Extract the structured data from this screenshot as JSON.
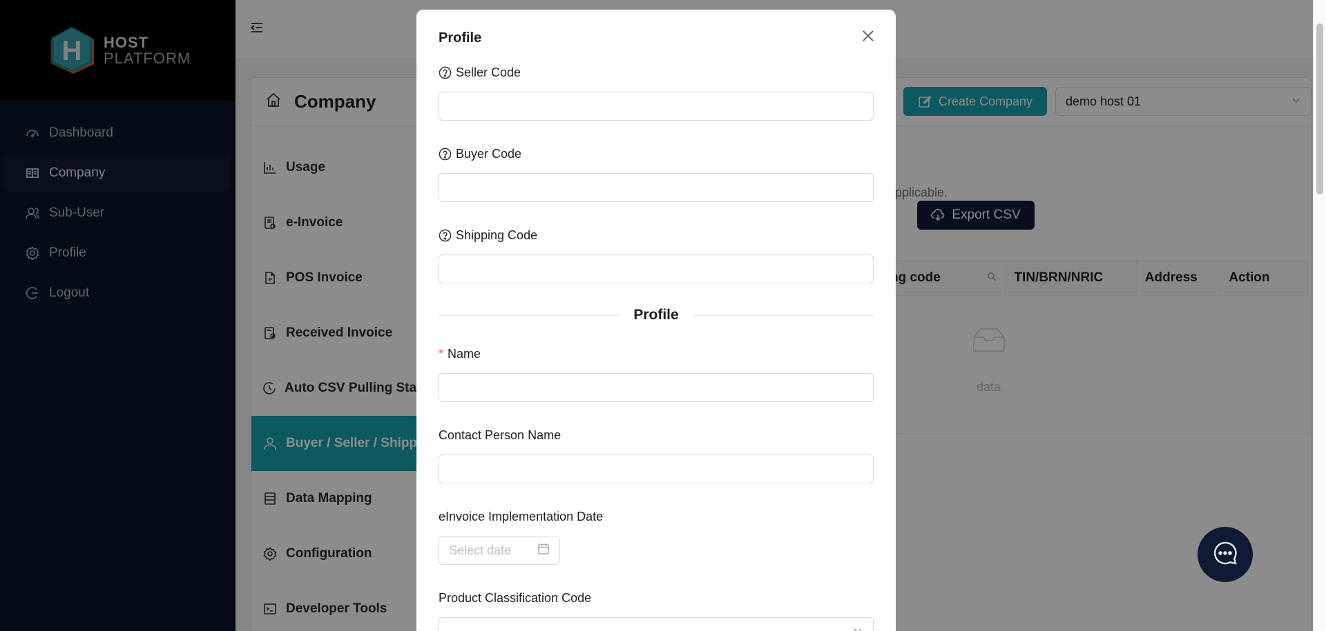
{
  "sidebar": {
    "logo": {
      "letter": "H",
      "line1": "HOST",
      "line2": "PLATFORM"
    },
    "items": [
      {
        "label": "Dashboard",
        "icon": "dashboard-icon",
        "active": false
      },
      {
        "label": "Company",
        "icon": "book-icon",
        "active": true
      },
      {
        "label": "Sub-User",
        "icon": "user-group-icon",
        "active": false
      },
      {
        "label": "Profile",
        "icon": "gear-icon",
        "active": false
      },
      {
        "label": "Logout",
        "icon": "logout-icon",
        "active": false
      }
    ]
  },
  "page": {
    "title": "Company",
    "create_label": "Create Company",
    "host_select_value": "demo host 01",
    "hint": "if applicable.",
    "export_label": "Export CSV",
    "tabs": [
      {
        "label": "Usage",
        "icon": "bar-chart-icon",
        "active": false
      },
      {
        "label": "e-Invoice",
        "icon": "invoice-icon",
        "active": false
      },
      {
        "label": "POS Invoice",
        "icon": "pos-file-icon",
        "active": false
      },
      {
        "label": "Received Invoice",
        "icon": "received-file-icon",
        "active": false
      },
      {
        "label": "Auto CSV Pulling Statu",
        "icon": "clock-icon",
        "active": false
      },
      {
        "label": "Buyer / Seller / Shippi",
        "icon": "user-icon",
        "active": true
      },
      {
        "label": "Data Mapping",
        "icon": "database-icon",
        "active": false
      },
      {
        "label": "Configuration",
        "icon": "settings-icon",
        "active": false
      },
      {
        "label": "Developer Tools",
        "icon": "terminal-icon",
        "active": false
      }
    ],
    "table_headers": [
      "ng code",
      "TIN/BRN/NRIC",
      "Address",
      "Action"
    ],
    "empty_text": "data"
  },
  "modal": {
    "title": "Profile",
    "fields_top": [
      {
        "label": "Seller Code",
        "value": ""
      },
      {
        "label": "Buyer Code",
        "value": ""
      },
      {
        "label": "Shipping Code",
        "value": ""
      }
    ],
    "divider_label": "Profile",
    "name_label": "Name",
    "name_value": "",
    "contact_label": "Contact Person Name",
    "contact_value": "",
    "date_label": "eInvoice Implementation Date",
    "date_placeholder": "Select date",
    "classification_label": "Product Classification Code"
  },
  "colors": {
    "sidebar_bg": "#0b1628",
    "accent": "#16a3b0",
    "dark_button": "#0f1a35",
    "required": "#ff4d4f"
  }
}
